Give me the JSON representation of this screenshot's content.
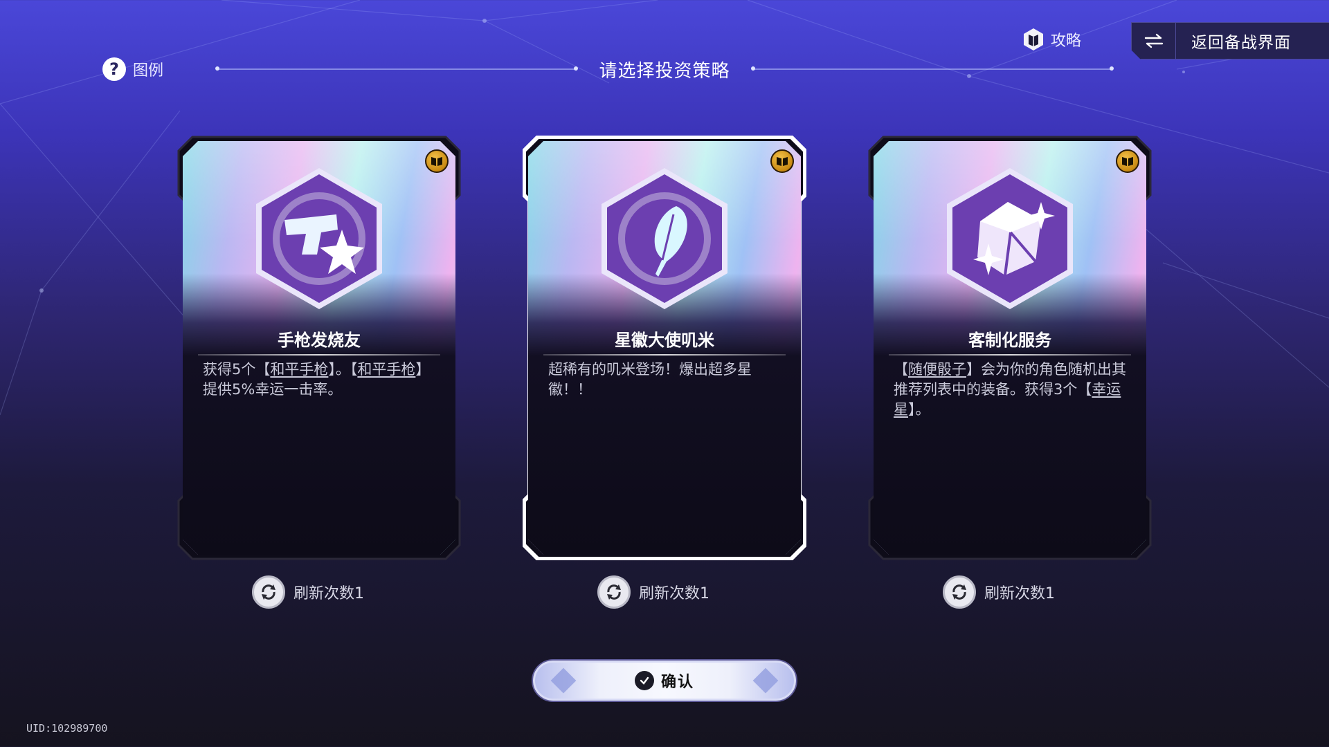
{
  "header": {
    "legend_label": "图例",
    "legend_icon": "question-icon",
    "title": "请选择投资策略",
    "guide_label": "攻略",
    "guide_icon": "guide-book-icon",
    "back_label": "返回备战界面",
    "back_icon": "swap-arrows-icon"
  },
  "cards": [
    {
      "name": "手枪发烧友",
      "icon": "pistol-star-icon",
      "desc_parts": [
        "获得5个【",
        "和平手枪",
        "】。【",
        "和平手枪",
        "】提供5%幸运一击率。"
      ],
      "refresh_label": "刷新次数1",
      "selected": false
    },
    {
      "name": "星徽大使叽米",
      "icon": "feather-emblem-icon",
      "desc_parts": [
        "超稀有的叽米登场！爆出超多星徽！！"
      ],
      "refresh_label": "刷新次数1",
      "selected": true
    },
    {
      "name": "客制化服务",
      "icon": "dice-sparkle-icon",
      "desc_parts": [
        "【",
        "随便骰子",
        "】会为你的角色随机出其推荐列表中的装备。获得3个【",
        "幸运星",
        "】。"
      ],
      "refresh_label": "刷新次数1",
      "selected": false
    }
  ],
  "confirm_label": "确认",
  "uid": "UID:102989700",
  "colors": {
    "bg_top": "#4a47d8",
    "bg_bottom": "#15131f",
    "badge_gold": "#f4c24a",
    "hex_purple": "#6c3fb0"
  }
}
